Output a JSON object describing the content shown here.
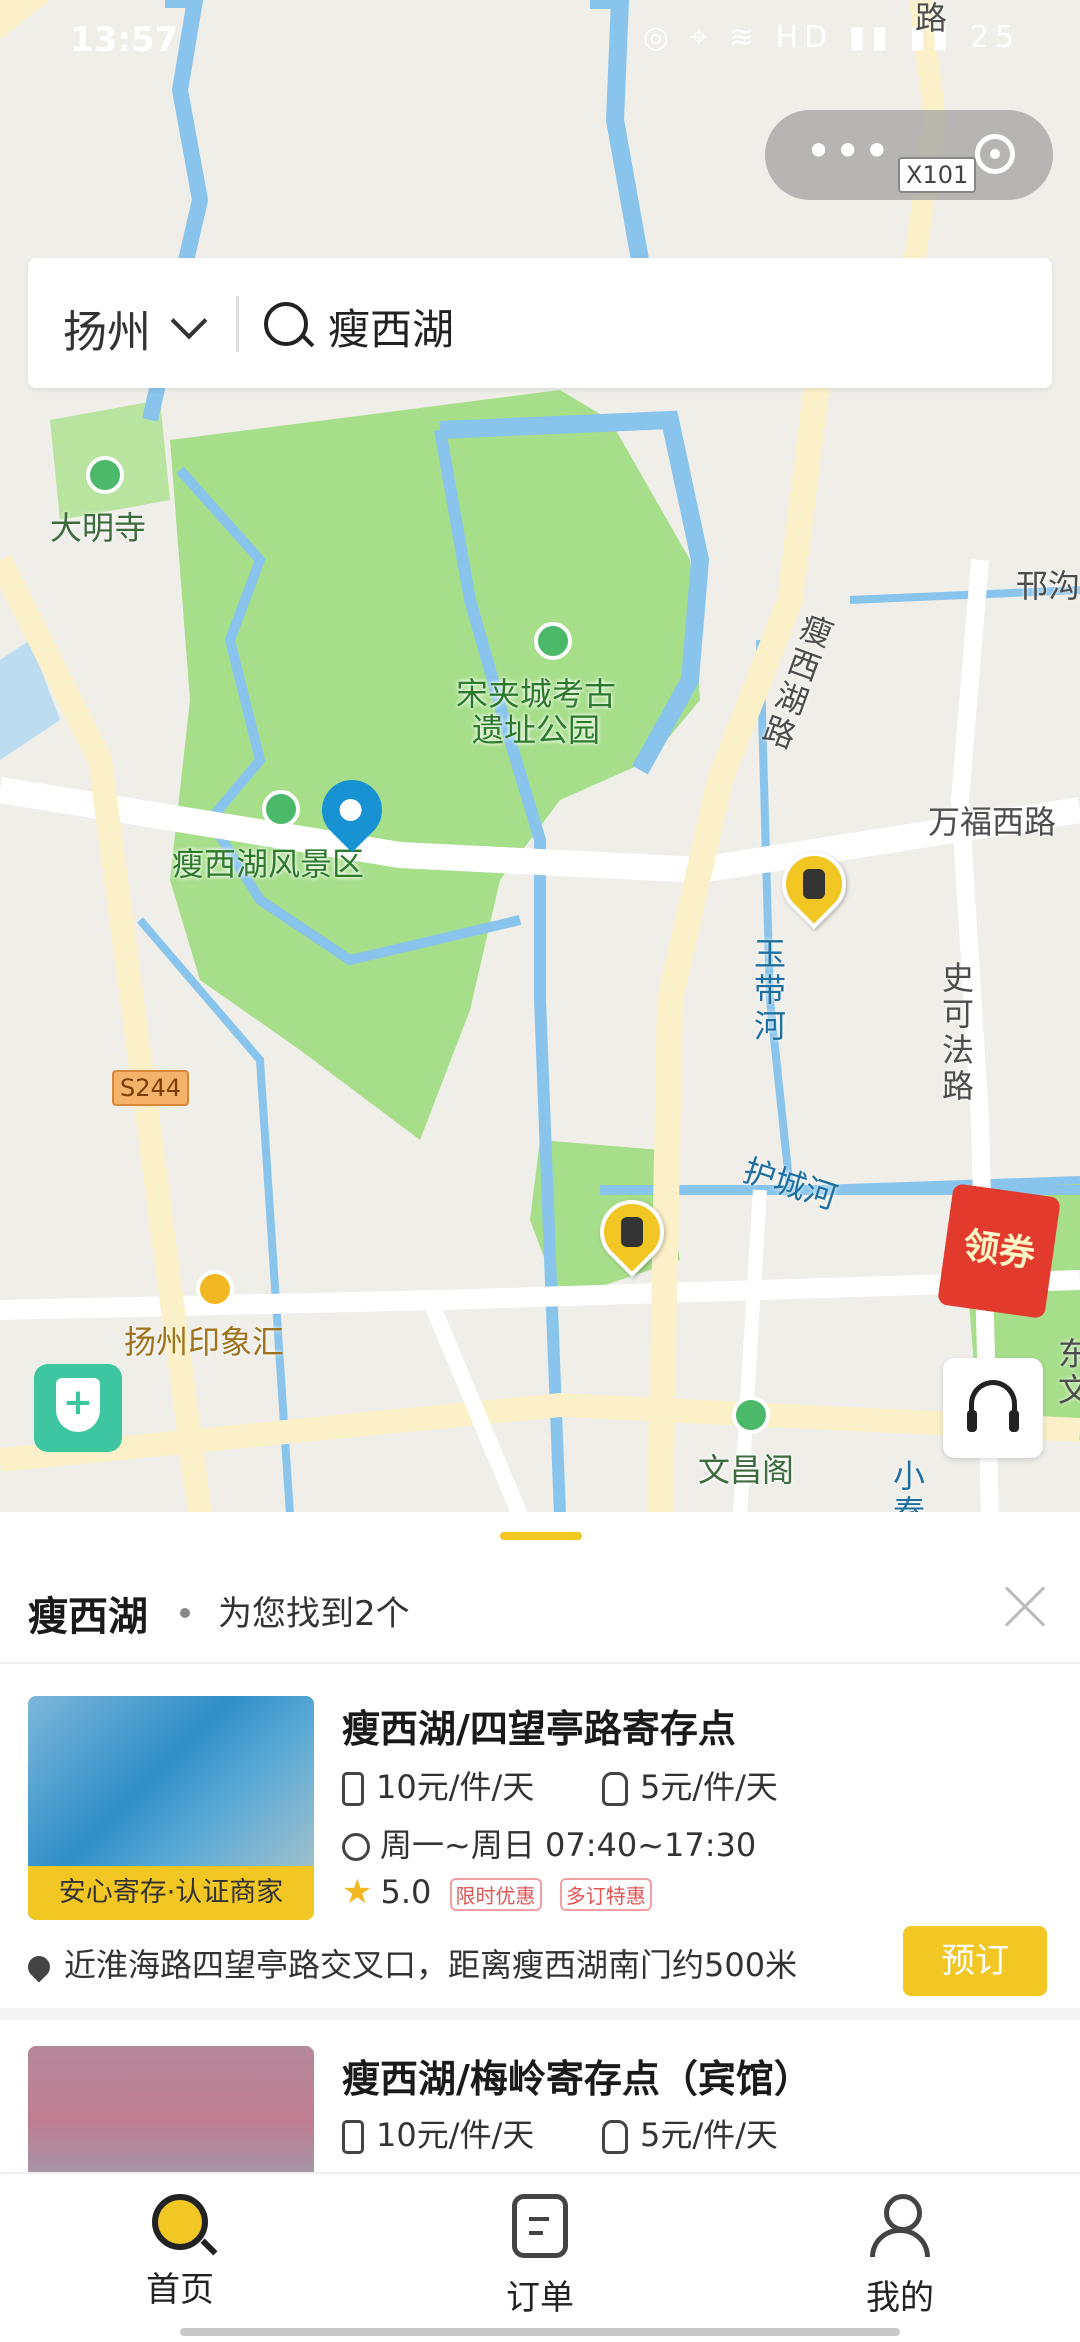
{
  "status_bar": {
    "time": "13:57",
    "indicators": "◎ ⌖ ≋ HD ▮▮ ▮▮ 25"
  },
  "mini_program": {
    "menu_dots": "•••"
  },
  "search": {
    "city": "扬州",
    "query": "瘦西湖"
  },
  "map": {
    "labels": {
      "daming_temple": "大明寺",
      "song_ruins": "宋夹城考古\n遗址公园",
      "scenic_area": "瘦西湖风景区",
      "shouxihu_road": "瘦西湖路",
      "wanfu_road": "万福西路",
      "yudai_river": "玉带河",
      "shikefa_road": "史可法路",
      "hucheng_river": "护城河",
      "yinxianghui": "扬州印象汇",
      "wenchang_pavilion": "文昌阁",
      "handou_road": "邗沟",
      "xiaoqin": "小秦",
      "road_top": "路",
      "east_label": "东\n文"
    },
    "road_badges": {
      "s244": "S244",
      "x101": "X101"
    },
    "coupon_label": "领券"
  },
  "results": {
    "keyword": "瘦西湖",
    "found_text": "为您找到2个",
    "items": [
      {
        "name": "瘦西湖/四望亭路寄存点",
        "price_luggage": "10元/件/天",
        "price_bag": "5元/件/天",
        "hours": "周一~周日 07:40~17:30",
        "rating": "5.0",
        "tags": [
          "限时优惠",
          "多订特惠"
        ],
        "badge": "安心寄存·认证商家",
        "address": "近淮海路四望亭路交叉口，距离瘦西湖南门约500米",
        "book_label": "预订"
      },
      {
        "name": "瘦西湖/梅岭寄存点（宾馆）",
        "price_luggage": "10元/件/天",
        "price_bag": "5元/件/天"
      }
    ]
  },
  "tabbar": {
    "home": "首页",
    "orders": "订单",
    "me": "我的"
  },
  "colors": {
    "accent": "#f2c623",
    "park_green": "#a6de8a",
    "water": "#89c4ec",
    "pin_blue": "#1792d2"
  }
}
